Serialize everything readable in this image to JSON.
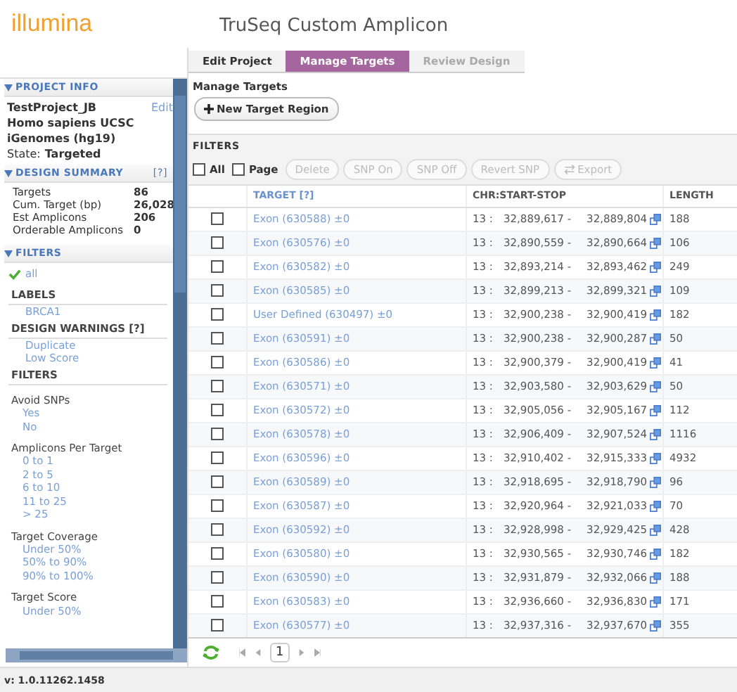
{
  "logo": "illumina",
  "title": "TruSeq Custom Amplicon",
  "sidebar": {
    "project_info": {
      "title": "PROJECT INFO",
      "edit": "Edit",
      "lines": [
        "TestProject_JB",
        "Homo sapiens UCSC",
        "iGenomes (hg19)"
      ],
      "state_label": "State:",
      "state": "Targeted"
    },
    "design_summary": {
      "title": "DESIGN SUMMARY",
      "help": "[?]",
      "rows": [
        {
          "label": "Targets",
          "value": "86"
        },
        {
          "label": "Cum. Target (bp)",
          "value": "26,028"
        },
        {
          "label": "Est Amplicons",
          "value": "206"
        },
        {
          "label": "Orderable Amplicons",
          "value": "0"
        }
      ]
    },
    "filters": {
      "title": "FILTERS",
      "all": "all",
      "all_checked": true,
      "sections": [
        {
          "kind": "heading",
          "title": "LABELS",
          "links": [
            "BRCA1"
          ]
        },
        {
          "kind": "heading",
          "title": "DESIGN WARNINGS [?]",
          "links": [
            "Duplicate",
            "Low Score"
          ]
        },
        {
          "kind": "heading",
          "title": "FILTERS"
        },
        {
          "kind": "group",
          "title": "Avoid SNPs",
          "links": [
            "Yes",
            "No"
          ]
        },
        {
          "kind": "group",
          "title": "Amplicons Per Target",
          "links": [
            "0 to 1",
            "2 to 5",
            "6 to 10",
            "11 to 25",
            "> 25"
          ]
        },
        {
          "kind": "group",
          "title": "Target Coverage",
          "links": [
            "Under 50%",
            "50% to 90%",
            "90% to 100%"
          ]
        },
        {
          "kind": "group",
          "title": "Target Score",
          "links": [
            "Under 50%"
          ]
        }
      ]
    }
  },
  "tabs": [
    {
      "label": "Edit Project",
      "selected": false
    },
    {
      "label": "Manage Targets",
      "selected": true
    },
    {
      "label": "Review Design",
      "selected": false
    }
  ],
  "section_title": "Manage Targets",
  "new_button": "New Target Region",
  "filters_bar": "FILTERS",
  "toolbar": {
    "all": "All",
    "all_checked": false,
    "page": "Page",
    "page_checked": false,
    "buttons": [
      "Delete",
      "SNP On",
      "SNP Off",
      "Revert SNP",
      "Export"
    ]
  },
  "table": {
    "columns": [
      "TARGET [?]",
      "CHR:START-STOP",
      "LENGTH"
    ],
    "rows": [
      {
        "checked": false,
        "target": "Exon (630588) ±0",
        "chr": "13 :",
        "start": "32,889,617 -",
        "stop": "32,889,804",
        "length": "188"
      },
      {
        "checked": false,
        "target": "Exon (630576) ±0",
        "chr": "13 :",
        "start": "32,890,559 -",
        "stop": "32,890,664",
        "length": "106"
      },
      {
        "checked": false,
        "target": "Exon (630582) ±0",
        "chr": "13 :",
        "start": "32,893,214 -",
        "stop": "32,893,462",
        "length": "249"
      },
      {
        "checked": false,
        "target": "Exon (630585) ±0",
        "chr": "13 :",
        "start": "32,899,213 -",
        "stop": "32,899,321",
        "length": "109"
      },
      {
        "checked": false,
        "target": "User Defined (630497) ±0",
        "chr": "13 :",
        "start": "32,900,238 -",
        "stop": "32,900,419",
        "length": "182"
      },
      {
        "checked": false,
        "target": "Exon (630591) ±0",
        "chr": "13 :",
        "start": "32,900,238 -",
        "stop": "32,900,287",
        "length": "50"
      },
      {
        "checked": false,
        "target": "Exon (630586) ±0",
        "chr": "13 :",
        "start": "32,900,379 -",
        "stop": "32,900,419",
        "length": "41"
      },
      {
        "checked": false,
        "target": "Exon (630571) ±0",
        "chr": "13 :",
        "start": "32,903,580 -",
        "stop": "32,903,629",
        "length": "50"
      },
      {
        "checked": false,
        "target": "Exon (630572) ±0",
        "chr": "13 :",
        "start": "32,905,056 -",
        "stop": "32,905,167",
        "length": "112"
      },
      {
        "checked": false,
        "target": "Exon (630578) ±0",
        "chr": "13 :",
        "start": "32,906,409 -",
        "stop": "32,907,524",
        "length": "1116"
      },
      {
        "checked": false,
        "target": "Exon (630596) ±0",
        "chr": "13 :",
        "start": "32,910,402 -",
        "stop": "32,915,333",
        "length": "4932"
      },
      {
        "checked": false,
        "target": "Exon (630589) ±0",
        "chr": "13 :",
        "start": "32,918,695 -",
        "stop": "32,918,790",
        "length": "96"
      },
      {
        "checked": false,
        "target": "Exon (630587) ±0",
        "chr": "13 :",
        "start": "32,920,964 -",
        "stop": "32,921,033",
        "length": "70"
      },
      {
        "checked": false,
        "target": "Exon (630592) ±0",
        "chr": "13 :",
        "start": "32,928,998 -",
        "stop": "32,929,425",
        "length": "428"
      },
      {
        "checked": false,
        "target": "Exon (630580) ±0",
        "chr": "13 :",
        "start": "32,930,565 -",
        "stop": "32,930,746",
        "length": "182"
      },
      {
        "checked": false,
        "target": "Exon (630590) ±0",
        "chr": "13 :",
        "start": "32,931,879 -",
        "stop": "32,932,066",
        "length": "188"
      },
      {
        "checked": false,
        "target": "Exon (630583) ±0",
        "chr": "13 :",
        "start": "32,936,660 -",
        "stop": "32,936,830",
        "length": "171"
      },
      {
        "checked": false,
        "target": "Exon (630577) ±0",
        "chr": "13 :",
        "start": "32,937,316 -",
        "stop": "32,937,670",
        "length": "355"
      }
    ]
  },
  "pager": {
    "page": "1"
  },
  "version": "v: 1.0.11262.1458"
}
